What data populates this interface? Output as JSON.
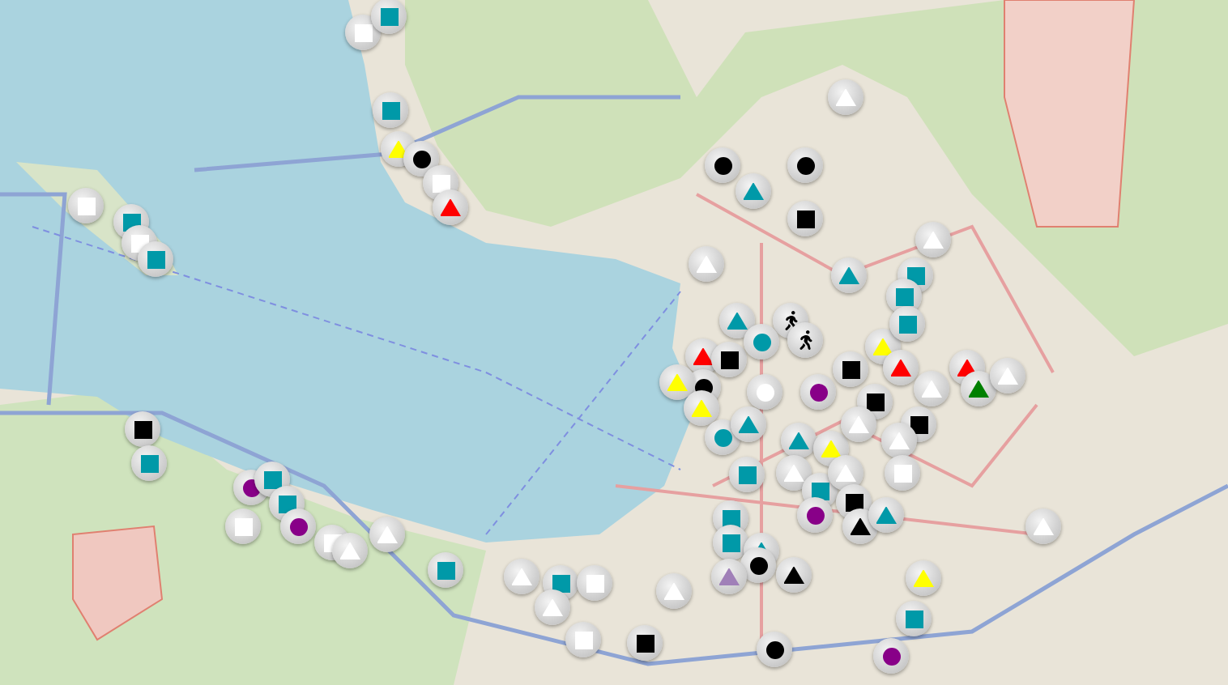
{
  "markers": [
    {
      "kind": "square",
      "color": "#ffffff"
    },
    {
      "kind": "square",
      "color": "#0099a8"
    },
    {
      "kind": "square",
      "color": "#0099a8"
    },
    {
      "kind": "triangle",
      "color": "#ffff00"
    },
    {
      "kind": "circle",
      "color": "#000000"
    },
    {
      "kind": "square",
      "color": "#ffffff"
    },
    {
      "kind": "triangle",
      "color": "#ff0000"
    },
    {
      "kind": "square",
      "color": "#ffffff"
    },
    {
      "kind": "square",
      "color": "#0099a8"
    },
    {
      "kind": "square",
      "color": "#ffffff"
    },
    {
      "kind": "square",
      "color": "#0099a8"
    },
    {
      "kind": "square",
      "color": "#000000"
    },
    {
      "kind": "square",
      "color": "#0099a8"
    },
    {
      "kind": "circle",
      "color": "#880088"
    },
    {
      "kind": "square",
      "color": "#0099a8"
    },
    {
      "kind": "square",
      "color": "#0099a8"
    },
    {
      "kind": "square",
      "color": "#ffffff"
    },
    {
      "kind": "circle",
      "color": "#880088"
    },
    {
      "kind": "square",
      "color": "#ffffff"
    },
    {
      "kind": "triangle",
      "color": "#ffffff"
    },
    {
      "kind": "triangle",
      "color": "#ffffff"
    },
    {
      "kind": "square",
      "color": "#0099a8"
    },
    {
      "kind": "triangle",
      "color": "#ffffff"
    },
    {
      "kind": "square",
      "color": "#0099a8"
    },
    {
      "kind": "triangle",
      "color": "#ffffff"
    },
    {
      "kind": "square",
      "color": "#ffffff"
    },
    {
      "kind": "square",
      "color": "#ffffff"
    },
    {
      "kind": "circle",
      "color": "#000000"
    },
    {
      "kind": "circle",
      "color": "#000000"
    },
    {
      "kind": "triangle",
      "color": "#0099a8"
    },
    {
      "kind": "triangle",
      "color": "#ffffff"
    },
    {
      "kind": "square",
      "color": "#000000"
    },
    {
      "kind": "triangle",
      "color": "#ffffff"
    },
    {
      "kind": "triangle",
      "color": "#0099a8"
    },
    {
      "kind": "triangle",
      "color": "#ffffff"
    },
    {
      "kind": "square",
      "color": "#0099a8"
    },
    {
      "kind": "square",
      "color": "#0099a8"
    },
    {
      "kind": "triangle",
      "color": "#0099a8"
    },
    {
      "kind": "walker",
      "color": "#000000"
    },
    {
      "kind": "walker",
      "color": "#000000"
    },
    {
      "kind": "triangle",
      "color": "#ff0000"
    },
    {
      "kind": "square",
      "color": "#000000"
    },
    {
      "kind": "circle",
      "color": "#000000"
    },
    {
      "kind": "triangle",
      "color": "#ffff00"
    },
    {
      "kind": "triangle",
      "color": "#ffff00"
    },
    {
      "kind": "circle",
      "color": "#0099a8"
    },
    {
      "kind": "circle",
      "color": "#ffffff"
    },
    {
      "kind": "triangle",
      "color": "#ffff00"
    },
    {
      "kind": "square",
      "color": "#0099a8"
    },
    {
      "kind": "triangle",
      "color": "#ff0000"
    },
    {
      "kind": "circle",
      "color": "#880088"
    },
    {
      "kind": "square",
      "color": "#000000"
    },
    {
      "kind": "square",
      "color": "#000000"
    },
    {
      "kind": "triangle",
      "color": "#ff0000"
    },
    {
      "kind": "triangle",
      "color": "#008000"
    },
    {
      "kind": "triangle",
      "color": "#ffffff"
    },
    {
      "kind": "triangle",
      "color": "#ffffff"
    },
    {
      "kind": "circle",
      "color": "#0099a8"
    },
    {
      "kind": "triangle",
      "color": "#0099a8"
    },
    {
      "kind": "triangle",
      "color": "#0099a8"
    },
    {
      "kind": "triangle",
      "color": "#ffff00"
    },
    {
      "kind": "triangle",
      "color": "#ffffff"
    },
    {
      "kind": "square",
      "color": "#000000"
    },
    {
      "kind": "triangle",
      "color": "#ffffff"
    },
    {
      "kind": "square",
      "color": "#0099a8"
    },
    {
      "kind": "triangle",
      "color": "#ffffff"
    },
    {
      "kind": "square",
      "color": "#0099a8"
    },
    {
      "kind": "triangle",
      "color": "#ffffff"
    },
    {
      "kind": "square",
      "color": "#ffffff"
    },
    {
      "kind": "circle",
      "color": "#880088"
    },
    {
      "kind": "square",
      "color": "#000000"
    },
    {
      "kind": "triangle",
      "color": "#000000"
    },
    {
      "kind": "triangle",
      "color": "#0099a8"
    },
    {
      "kind": "square",
      "color": "#0099a8"
    },
    {
      "kind": "square",
      "color": "#0099a8"
    },
    {
      "kind": "triangle",
      "color": "#0099a8"
    },
    {
      "kind": "circle",
      "color": "#000000"
    },
    {
      "kind": "triangle",
      "color": "#a080b8"
    },
    {
      "kind": "triangle",
      "color": "#000000"
    },
    {
      "kind": "triangle",
      "color": "#ffffff"
    },
    {
      "kind": "triangle",
      "color": "#ffff00"
    },
    {
      "kind": "square",
      "color": "#0099a8"
    },
    {
      "kind": "triangle",
      "color": "#ffffff"
    },
    {
      "kind": "square",
      "color": "#000000"
    },
    {
      "kind": "circle",
      "color": "#000000"
    },
    {
      "kind": "circle",
      "color": "#880088"
    }
  ]
}
